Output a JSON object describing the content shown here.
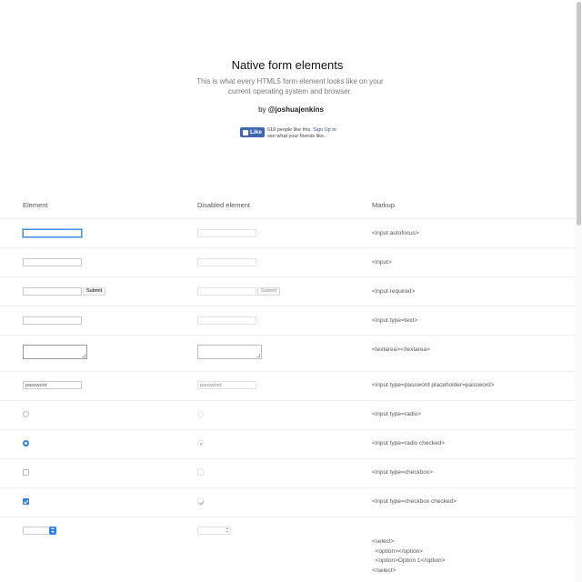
{
  "header": {
    "title": "Native form elements",
    "subtitle": "This is what every HTML5 form element looks like on your current operating system and browser.",
    "by_prefix": "by ",
    "by_handle": "@joshuajenkins"
  },
  "facebook": {
    "like_label": "Like",
    "count_text": "619 people like this.",
    "signup_link": "Sign Up",
    "suffix_text": " to see what your friends like."
  },
  "columns": {
    "element": "Element",
    "disabled": "Disabled element",
    "markup": "Markup"
  },
  "rows": [
    {
      "markup": "<input autofocus>"
    },
    {
      "markup": "<input>"
    },
    {
      "markup": "<input required>",
      "button_label": "Submit"
    },
    {
      "markup": "<input type=text>"
    },
    {
      "markup": "<textarea></textarea>"
    },
    {
      "markup": "<input type=password placeholder=password>",
      "placeholder": "password"
    },
    {
      "markup": "<input type=radio>"
    },
    {
      "markup": "<input type=radio checked>"
    },
    {
      "markup": "<input type=checkbox>"
    },
    {
      "markup": "<input type=checkbox checked>"
    },
    {
      "markup_lines": [
        "<select>",
        "  <option></option>",
        "  <option>Option 1</option>",
        "</select>"
      ]
    }
  ],
  "colors": {
    "accent": "#2f80ed",
    "facebook": "#4267b2"
  }
}
